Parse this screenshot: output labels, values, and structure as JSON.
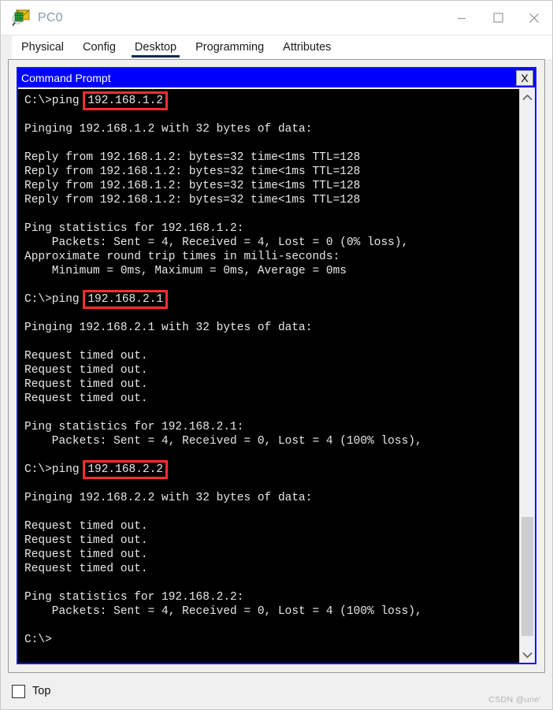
{
  "window": {
    "title": "PC0",
    "icon": "packet-tracer-pc-icon",
    "controls": {
      "minimize": "—",
      "maximize": "□",
      "close": "✕"
    }
  },
  "tabs": [
    {
      "label": "Physical",
      "active": false
    },
    {
      "label": "Config",
      "active": false
    },
    {
      "label": "Desktop",
      "active": true
    },
    {
      "label": "Programming",
      "active": false
    },
    {
      "label": "Attributes",
      "active": false
    }
  ],
  "command_prompt": {
    "title": "Command Prompt",
    "close_label": "X",
    "lines": [
      {
        "pre": "C:\\>ping ",
        "highlight": "192.168.1.2",
        "post": ""
      },
      {
        "pre": "",
        "highlight": null,
        "post": ""
      },
      {
        "pre": "Pinging 192.168.1.2 with 32 bytes of data:",
        "highlight": null,
        "post": ""
      },
      {
        "pre": "",
        "highlight": null,
        "post": ""
      },
      {
        "pre": "Reply from 192.168.1.2: bytes=32 time<1ms TTL=128",
        "highlight": null,
        "post": ""
      },
      {
        "pre": "Reply from 192.168.1.2: bytes=32 time<1ms TTL=128",
        "highlight": null,
        "post": ""
      },
      {
        "pre": "Reply from 192.168.1.2: bytes=32 time<1ms TTL=128",
        "highlight": null,
        "post": ""
      },
      {
        "pre": "Reply from 192.168.1.2: bytes=32 time<1ms TTL=128",
        "highlight": null,
        "post": ""
      },
      {
        "pre": "",
        "highlight": null,
        "post": ""
      },
      {
        "pre": "Ping statistics for 192.168.1.2:",
        "highlight": null,
        "post": ""
      },
      {
        "pre": "    Packets: Sent = 4, Received = 4, Lost = 0 (0% loss),",
        "highlight": null,
        "post": ""
      },
      {
        "pre": "Approximate round trip times in milli-seconds:",
        "highlight": null,
        "post": ""
      },
      {
        "pre": "    Minimum = 0ms, Maximum = 0ms, Average = 0ms",
        "highlight": null,
        "post": ""
      },
      {
        "pre": "",
        "highlight": null,
        "post": ""
      },
      {
        "pre": "C:\\>ping ",
        "highlight": "192.168.2.1",
        "post": ""
      },
      {
        "pre": "",
        "highlight": null,
        "post": ""
      },
      {
        "pre": "Pinging 192.168.2.1 with 32 bytes of data:",
        "highlight": null,
        "post": ""
      },
      {
        "pre": "",
        "highlight": null,
        "post": ""
      },
      {
        "pre": "Request timed out.",
        "highlight": null,
        "post": ""
      },
      {
        "pre": "Request timed out.",
        "highlight": null,
        "post": ""
      },
      {
        "pre": "Request timed out.",
        "highlight": null,
        "post": ""
      },
      {
        "pre": "Request timed out.",
        "highlight": null,
        "post": ""
      },
      {
        "pre": "",
        "highlight": null,
        "post": ""
      },
      {
        "pre": "Ping statistics for 192.168.2.1:",
        "highlight": null,
        "post": ""
      },
      {
        "pre": "    Packets: Sent = 4, Received = 0, Lost = 4 (100% loss),",
        "highlight": null,
        "post": ""
      },
      {
        "pre": "",
        "highlight": null,
        "post": ""
      },
      {
        "pre": "C:\\>ping ",
        "highlight": "192.168.2.2",
        "post": ""
      },
      {
        "pre": "",
        "highlight": null,
        "post": ""
      },
      {
        "pre": "Pinging 192.168.2.2 with 32 bytes of data:",
        "highlight": null,
        "post": ""
      },
      {
        "pre": "",
        "highlight": null,
        "post": ""
      },
      {
        "pre": "Request timed out.",
        "highlight": null,
        "post": ""
      },
      {
        "pre": "Request timed out.",
        "highlight": null,
        "post": ""
      },
      {
        "pre": "Request timed out.",
        "highlight": null,
        "post": ""
      },
      {
        "pre": "Request timed out.",
        "highlight": null,
        "post": ""
      },
      {
        "pre": "",
        "highlight": null,
        "post": ""
      },
      {
        "pre": "Ping statistics for 192.168.2.2:",
        "highlight": null,
        "post": ""
      },
      {
        "pre": "    Packets: Sent = 4, Received = 0, Lost = 4 (100% loss),",
        "highlight": null,
        "post": ""
      },
      {
        "pre": "",
        "highlight": null,
        "post": ""
      },
      {
        "pre": "C:\\>",
        "highlight": null,
        "post": ""
      }
    ],
    "scrollbar": {
      "up_arrow": "chevron-up-icon",
      "down_arrow": "chevron-down-icon",
      "thumb_top_percent": 76,
      "thumb_height_percent": 22
    }
  },
  "footer": {
    "top_checkbox_label": "Top",
    "top_checkbox_checked": false,
    "watermark": "CSDN @une'"
  },
  "colors": {
    "cmd_titlebar": "#0000ff",
    "terminal_bg": "#000000",
    "terminal_fg": "#e8e8e8",
    "highlight_box": "#ff2d2d",
    "active_tab_underline": "#13294b"
  }
}
